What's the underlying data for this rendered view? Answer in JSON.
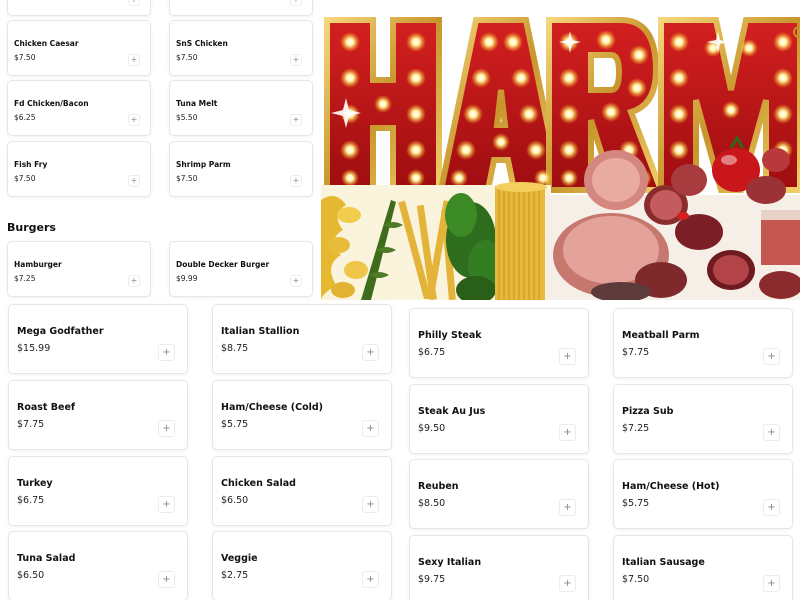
{
  "top_menu": {
    "section_title": "Burgers",
    "items": [
      {
        "name": "Chicken Caesar",
        "price": "$7.50"
      },
      {
        "name": "SnS Chicken",
        "price": "$7.50"
      },
      {
        "name": "Fd Chicken/Bacon",
        "price": "$6.25"
      },
      {
        "name": "Tuna Melt",
        "price": "$5.50"
      },
      {
        "name": "Fish Fry",
        "price": "$7.50"
      },
      {
        "name": "Shrimp Parm",
        "price": "$7.50"
      },
      {
        "name": "Hamburger",
        "price": "$7.25"
      },
      {
        "name": "Double Decker Burger",
        "price": "$9.99"
      }
    ]
  },
  "hero": {
    "banner_text": "HARM"
  },
  "main_menu": {
    "items": [
      {
        "name": "Mega Godfather",
        "price": "$15.99"
      },
      {
        "name": "Italian Stallion",
        "price": "$8.75"
      },
      {
        "name": "Philly Steak",
        "price": "$6.75"
      },
      {
        "name": "Meatball Parm",
        "price": "$7.75"
      },
      {
        "name": "Roast Beef",
        "price": "$7.75"
      },
      {
        "name": "Ham/Cheese (Cold)",
        "price": "$5.75"
      },
      {
        "name": "Steak Au Jus",
        "price": "$9.50"
      },
      {
        "name": "Pizza Sub",
        "price": "$7.25"
      },
      {
        "name": "Turkey",
        "price": "$6.75"
      },
      {
        "name": "Chicken Salad",
        "price": "$6.50"
      },
      {
        "name": "Reuben",
        "price": "$8.50"
      },
      {
        "name": "Ham/Cheese (Hot)",
        "price": "$5.75"
      },
      {
        "name": "Tuna Salad",
        "price": "$6.50"
      },
      {
        "name": "Veggie",
        "price": "$2.75"
      },
      {
        "name": "Sexy Italian",
        "price": "$9.75"
      },
      {
        "name": "Italian Sausage",
        "price": "$7.50"
      }
    ]
  },
  "add_label": "+",
  "colors": {
    "card_border": "#e6e6e6",
    "letter_red": "#c8171b",
    "letter_gold": "#d8a838",
    "bulb": "#ffe98a"
  },
  "icons": [
    "plus-icon"
  ]
}
